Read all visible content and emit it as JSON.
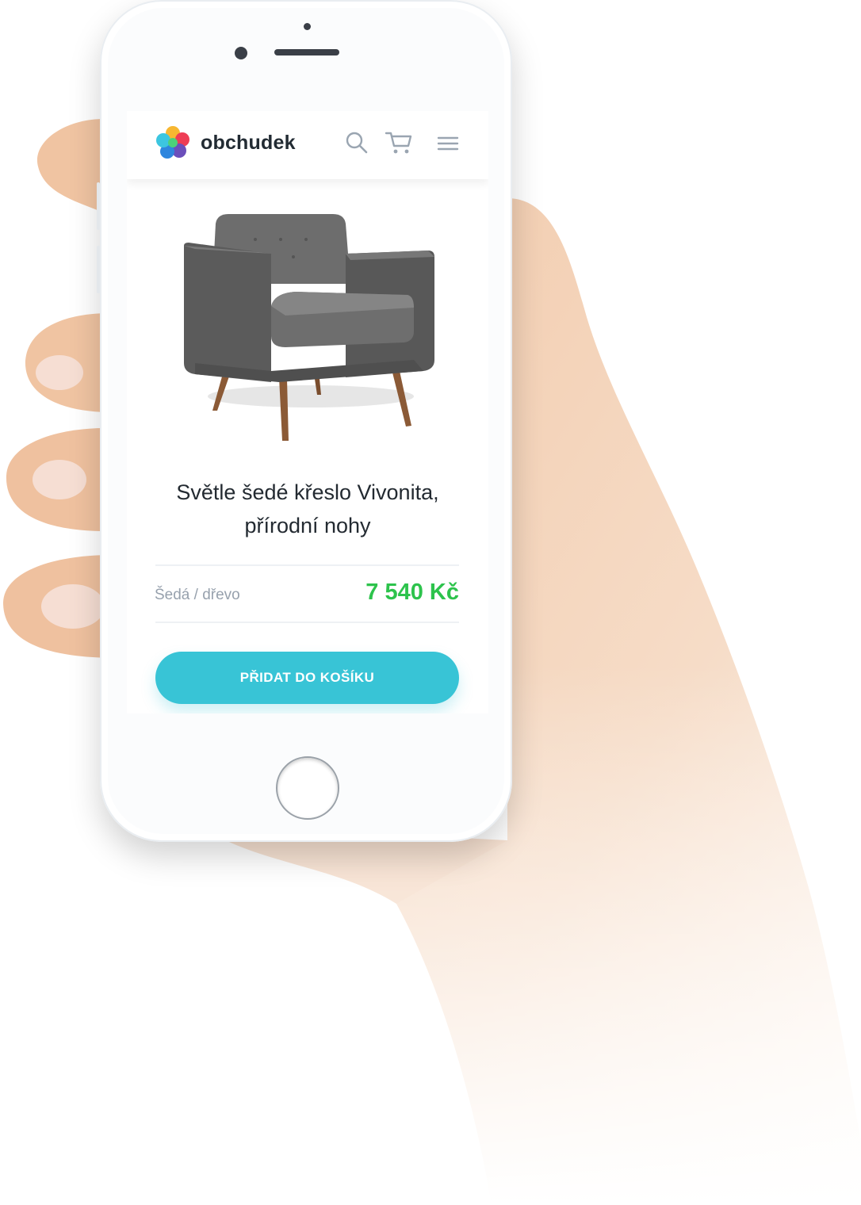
{
  "header": {
    "brand": "obchudek",
    "icons": [
      "search-icon",
      "cart-icon",
      "menu-icon"
    ]
  },
  "product": {
    "image": "armchair-image",
    "title_line1": "Světle šedé křeslo Vivonita,",
    "title_line2": "přírodní nohy",
    "variant": "Šedá / dřevo",
    "price": "7 540 Kč",
    "cta_label": "PŘIDAT DO KOŠÍKU"
  },
  "colors": {
    "accent": "#38c4d6",
    "price": "#2dc34c",
    "text": "#232a31",
    "muted": "#97a1ad"
  }
}
